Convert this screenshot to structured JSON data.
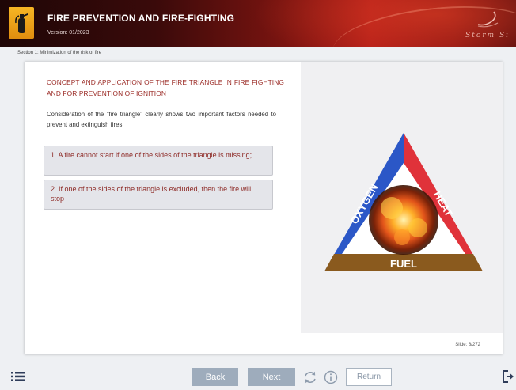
{
  "header": {
    "title": "FIRE PREVENTION AND FIRE-FIGHTING",
    "version": "Version: 01/2023",
    "brand": "Storm Si"
  },
  "breadcrumb": "Section 1: Minimization of the risk of fire",
  "content": {
    "heading": "CONCEPT AND APPLICATION OF THE FIRE TRIANGLE IN FIRE FIGHTING AND FOR PREVENTION OF IGNITION",
    "intro": "Consideration of the \"fire triangle\" clearly shows two important factors needed to prevent and extinguish fires:",
    "points": [
      "1. A fire cannot start if one of the sides of the triangle is missing;",
      "2. If one of the sides of the triangle is excluded, then the fire will stop"
    ]
  },
  "triangle": {
    "left": "OXYGEN",
    "right": "HEAT",
    "bottom": "FUEL",
    "colors": {
      "left": "#2b57c7",
      "right": "#e0323a",
      "bottom": "#8a5a1e"
    }
  },
  "slide_counter": "Slide: 8/272",
  "footer": {
    "back": "Back",
    "next": "Next",
    "return": "Return",
    "accent": "#9eacbc"
  },
  "icons": [
    "menu-icon",
    "refresh-icon",
    "info-icon",
    "exit-icon",
    "fire-extinguisher-icon"
  ]
}
